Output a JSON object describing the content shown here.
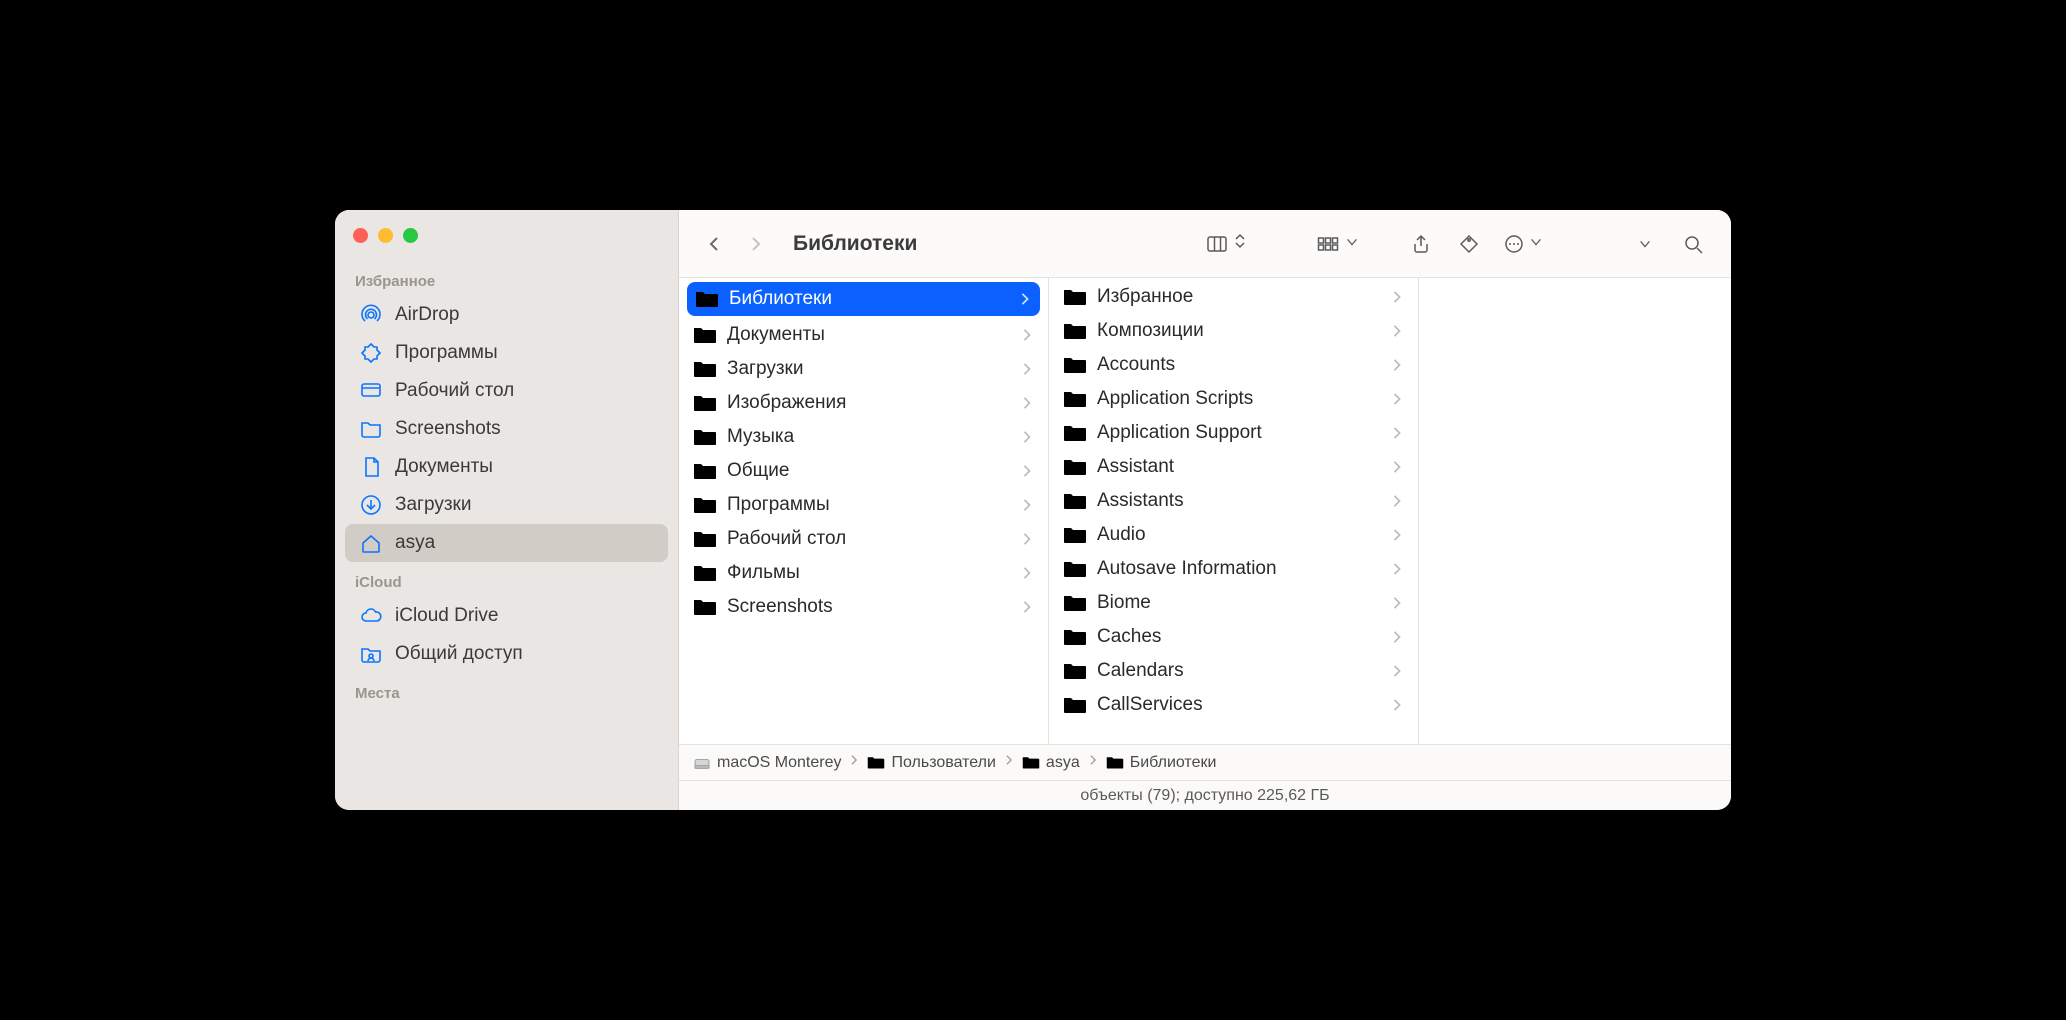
{
  "window": {
    "title": "Библиотеки"
  },
  "sidebar": {
    "sections": [
      {
        "header": "Избранное",
        "items": [
          {
            "icon": "airdrop",
            "label": "AirDrop",
            "selected": false
          },
          {
            "icon": "apps",
            "label": "Программы",
            "selected": false
          },
          {
            "icon": "desktop",
            "label": "Рабочий стол",
            "selected": false
          },
          {
            "icon": "folder",
            "label": "Screenshots",
            "selected": false
          },
          {
            "icon": "documents",
            "label": "Документы",
            "selected": false
          },
          {
            "icon": "downloads",
            "label": "Загрузки",
            "selected": false
          },
          {
            "icon": "home",
            "label": "asya",
            "selected": true
          }
        ]
      },
      {
        "header": "iCloud",
        "items": [
          {
            "icon": "cloud",
            "label": "iCloud Drive",
            "selected": false
          },
          {
            "icon": "shared",
            "label": "Общий доступ",
            "selected": false
          }
        ]
      },
      {
        "header": "Места",
        "items": []
      }
    ]
  },
  "columns": [
    {
      "items": [
        {
          "name": "Библиотеки",
          "selected": true
        },
        {
          "name": "Документы",
          "selected": false
        },
        {
          "name": "Загрузки",
          "selected": false
        },
        {
          "name": "Изображения",
          "selected": false
        },
        {
          "name": "Музыка",
          "selected": false
        },
        {
          "name": "Общие",
          "selected": false
        },
        {
          "name": "Программы",
          "selected": false
        },
        {
          "name": "Рабочий стол",
          "selected": false
        },
        {
          "name": "Фильмы",
          "selected": false
        },
        {
          "name": "Screenshots",
          "selected": false
        }
      ]
    },
    {
      "items": [
        {
          "name": "Избранное"
        },
        {
          "name": "Композиции"
        },
        {
          "name": "Accounts"
        },
        {
          "name": "Application Scripts"
        },
        {
          "name": "Application Support"
        },
        {
          "name": "Assistant"
        },
        {
          "name": "Assistants"
        },
        {
          "name": "Audio"
        },
        {
          "name": "Autosave Information"
        },
        {
          "name": "Biome"
        },
        {
          "name": "Caches"
        },
        {
          "name": "Calendars"
        },
        {
          "name": "CallServices"
        }
      ]
    },
    {
      "items": []
    }
  ],
  "path": [
    {
      "icon": "disk",
      "label": "macOS Monterey"
    },
    {
      "icon": "folder",
      "label": "Пользователи"
    },
    {
      "icon": "folder",
      "label": "asya"
    },
    {
      "icon": "folder",
      "label": "Библиотеки"
    }
  ],
  "status": "объекты (79); доступно 225,62 ГБ"
}
